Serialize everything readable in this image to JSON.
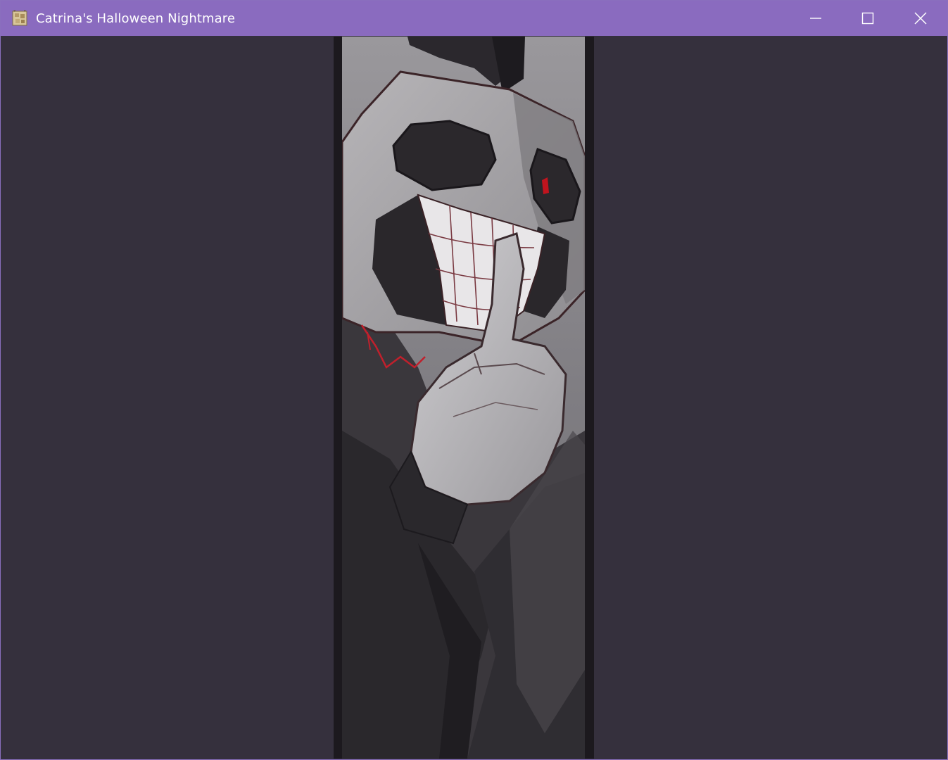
{
  "window": {
    "title": "Catrina's Halloween Nightmare",
    "icon": "game-app-icon",
    "controls": {
      "minimize": "minimize-icon",
      "maximize": "maximize-icon",
      "close": "close-icon"
    }
  },
  "scene": {
    "artwork": "grinning-masked-figure-illustration"
  },
  "colors": {
    "titlebar": "#8a6bbf",
    "background": "#35303d",
    "eye_glow": "#c0141e"
  }
}
